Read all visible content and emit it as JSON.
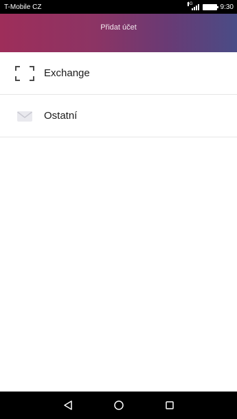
{
  "status_bar": {
    "carrier": "T-Mobile CZ",
    "network_type": "4G",
    "time": "9:30"
  },
  "header": {
    "title": "Přidat účet"
  },
  "accounts": [
    {
      "label": "Exchange",
      "icon": "exchange-icon"
    },
    {
      "label": "Ostatní",
      "icon": "mail-icon"
    }
  ],
  "nav_bar": {
    "buttons": [
      "back-icon",
      "home-icon",
      "recents-icon"
    ]
  },
  "colors": {
    "header_gradient_start": "#9e2e5a",
    "header_gradient_end": "#4a4c86",
    "status_bar_bg": "#000000",
    "nav_bar_bg": "#000000"
  }
}
